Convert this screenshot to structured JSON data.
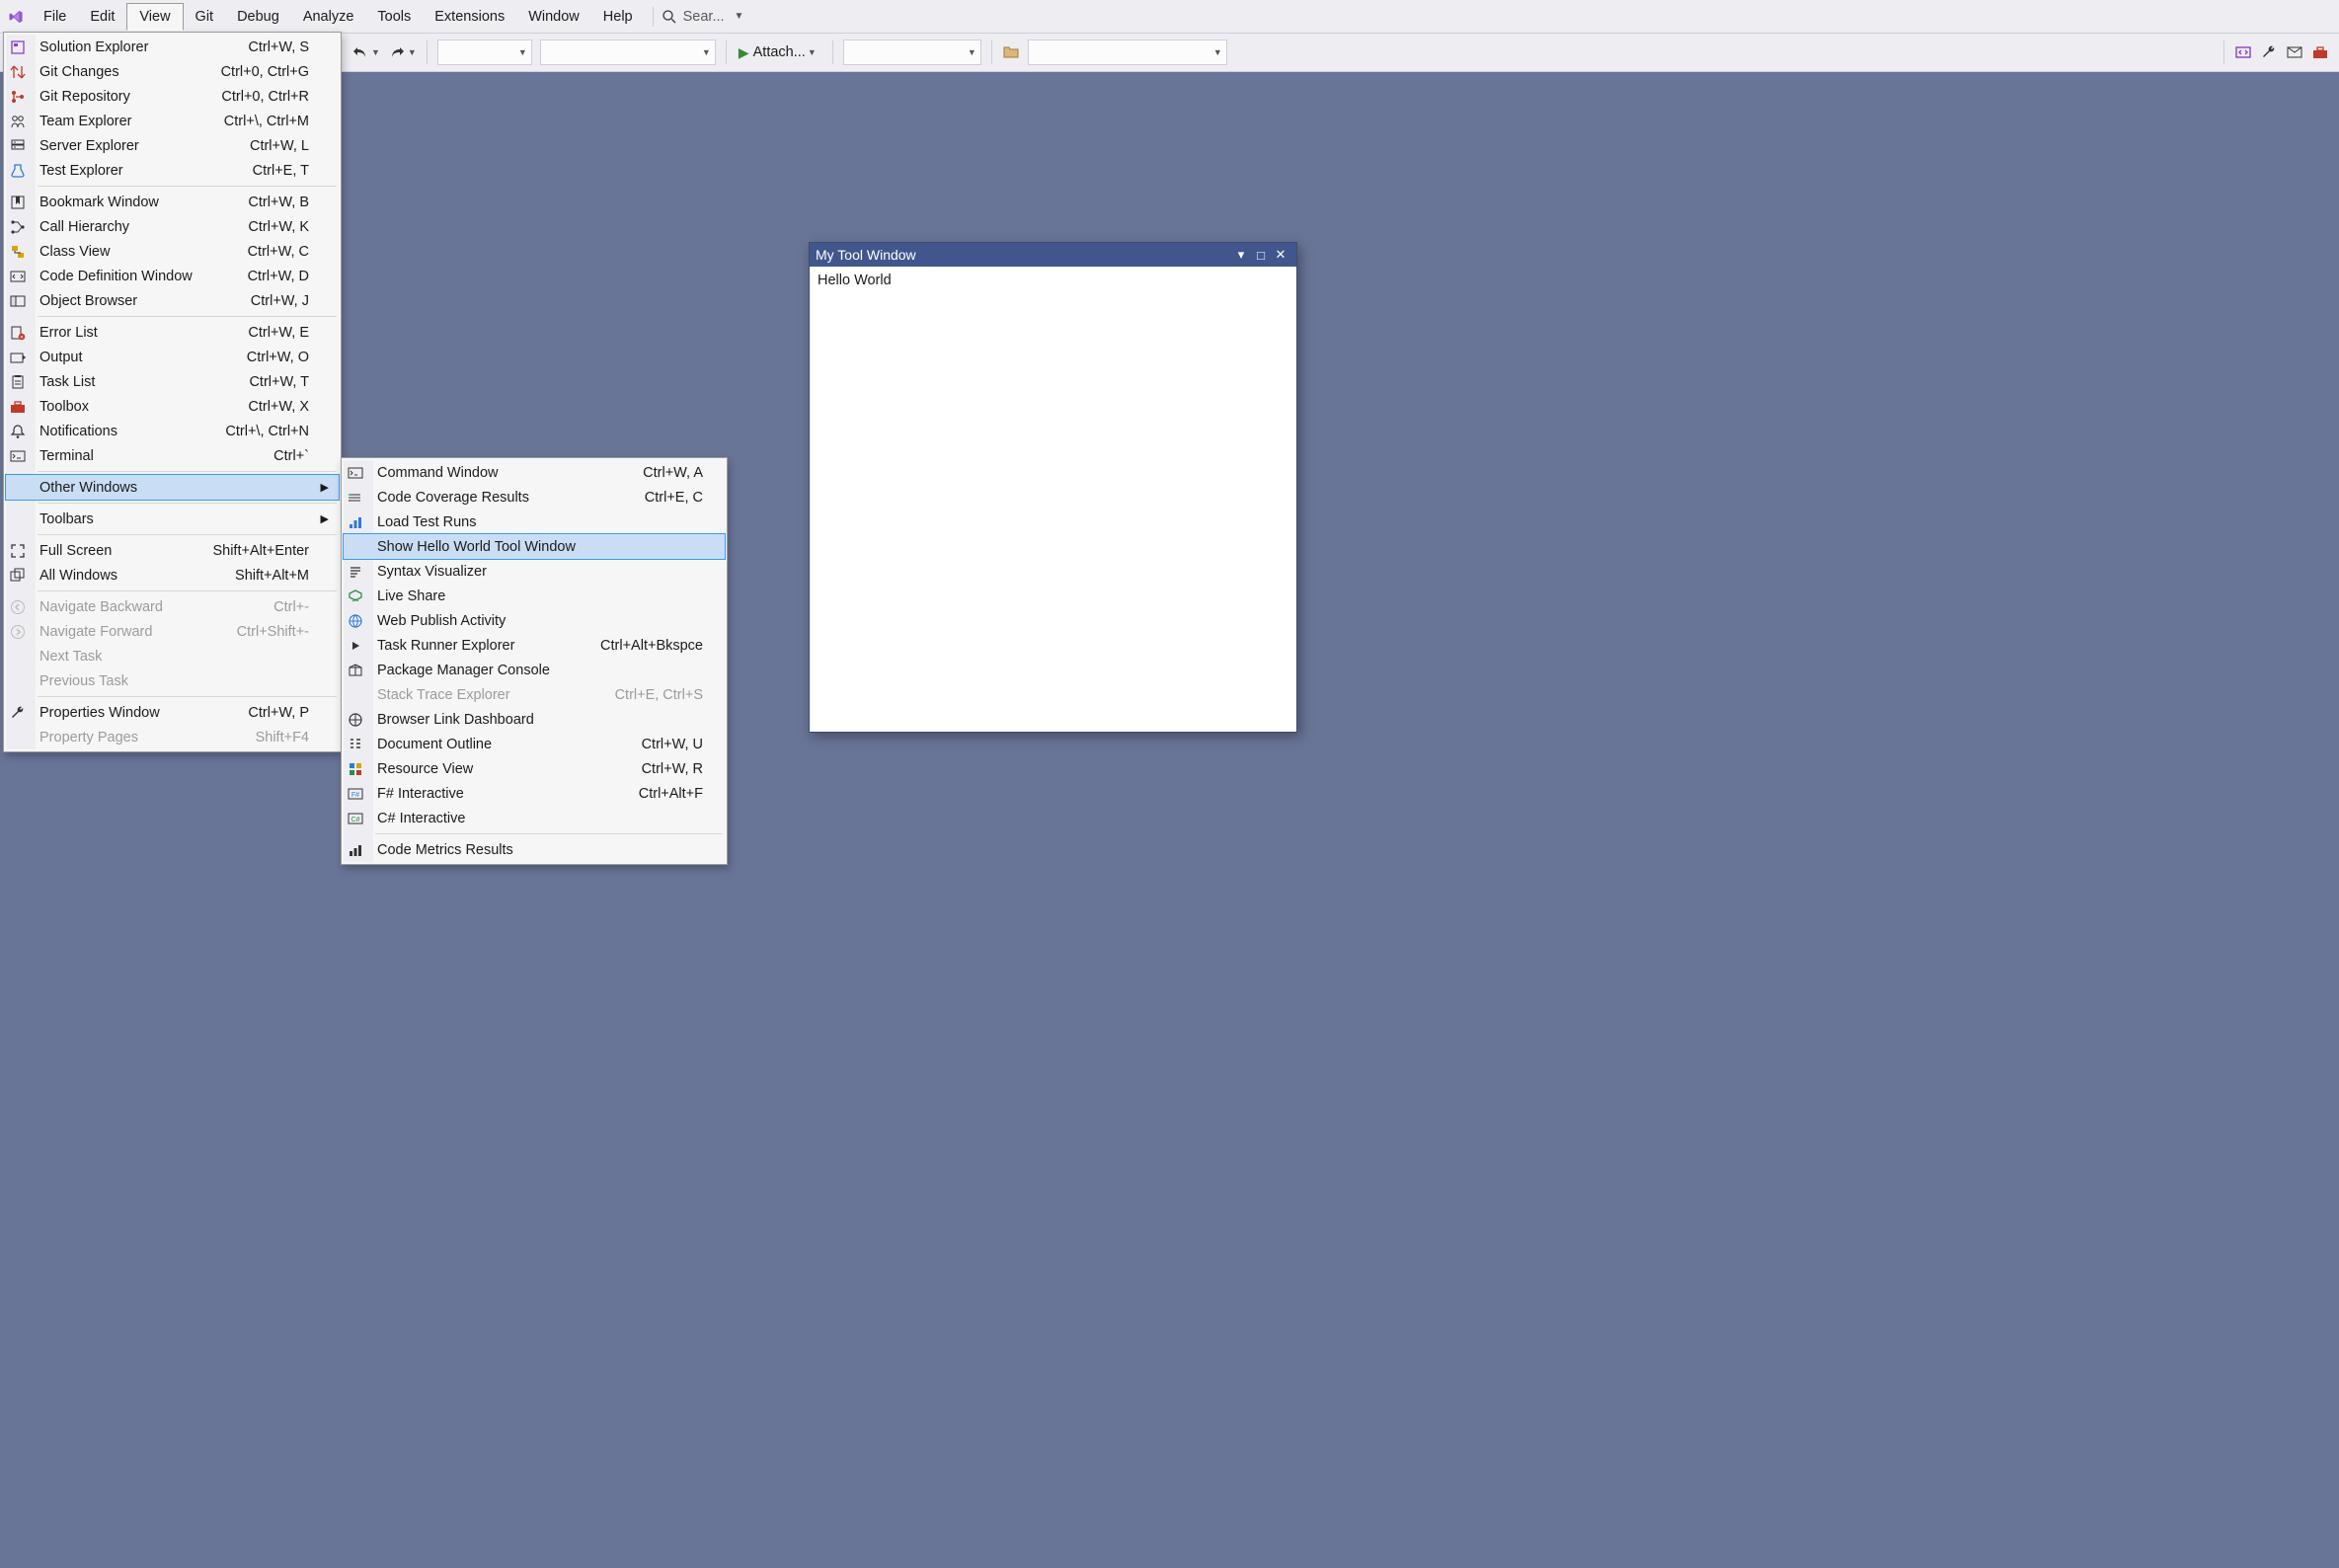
{
  "menubar": {
    "items": [
      "File",
      "Edit",
      "View",
      "Git",
      "Debug",
      "Analyze",
      "Tools",
      "Extensions",
      "Window",
      "Help"
    ],
    "active_index": 2,
    "search_placeholder": "Sear..."
  },
  "toolbar": {
    "attach_label": "Attach..."
  },
  "view_menu": {
    "groups": [
      [
        {
          "icon": "solution-explorer-icon",
          "label": "Solution Explorer",
          "shortcut": "Ctrl+W, S"
        },
        {
          "icon": "git-changes-icon",
          "label": "Git Changes",
          "shortcut": "Ctrl+0, Ctrl+G"
        },
        {
          "icon": "git-repo-icon",
          "label": "Git Repository",
          "shortcut": "Ctrl+0, Ctrl+R"
        },
        {
          "icon": "team-explorer-icon",
          "label": "Team Explorer",
          "shortcut": "Ctrl+\\, Ctrl+M"
        },
        {
          "icon": "server-explorer-icon",
          "label": "Server Explorer",
          "shortcut": "Ctrl+W, L"
        },
        {
          "icon": "test-explorer-icon",
          "label": "Test Explorer",
          "shortcut": "Ctrl+E, T"
        }
      ],
      [
        {
          "icon": "bookmark-window-icon",
          "label": "Bookmark Window",
          "shortcut": "Ctrl+W, B"
        },
        {
          "icon": "call-hierarchy-icon",
          "label": "Call Hierarchy",
          "shortcut": "Ctrl+W, K"
        },
        {
          "icon": "class-view-icon",
          "label": "Class View",
          "shortcut": "Ctrl+W, C"
        },
        {
          "icon": "code-def-window-icon",
          "label": "Code Definition Window",
          "shortcut": "Ctrl+W, D"
        },
        {
          "icon": "object-browser-icon",
          "label": "Object Browser",
          "shortcut": "Ctrl+W, J"
        }
      ],
      [
        {
          "icon": "error-list-icon",
          "label": "Error List",
          "shortcut": "Ctrl+W, E"
        },
        {
          "icon": "output-icon",
          "label": "Output",
          "shortcut": "Ctrl+W, O"
        },
        {
          "icon": "task-list-icon",
          "label": "Task List",
          "shortcut": "Ctrl+W, T"
        },
        {
          "icon": "toolbox-icon",
          "label": "Toolbox",
          "shortcut": "Ctrl+W, X"
        },
        {
          "icon": "notifications-icon",
          "label": "Notifications",
          "shortcut": "Ctrl+\\, Ctrl+N"
        },
        {
          "icon": "terminal-icon",
          "label": "Terminal",
          "shortcut": "Ctrl+`"
        }
      ],
      [
        {
          "icon": "",
          "label": "Other Windows",
          "shortcut": "",
          "submenu": true,
          "highlight": true
        }
      ],
      [
        {
          "icon": "",
          "label": "Toolbars",
          "shortcut": "",
          "submenu": true
        }
      ],
      [
        {
          "icon": "full-screen-icon",
          "label": "Full Screen",
          "shortcut": "Shift+Alt+Enter"
        },
        {
          "icon": "all-windows-icon",
          "label": "All Windows",
          "shortcut": "Shift+Alt+M"
        }
      ],
      [
        {
          "icon": "nav-back-icon",
          "label": "Navigate Backward",
          "shortcut": "Ctrl+-",
          "disabled": true
        },
        {
          "icon": "nav-fwd-icon",
          "label": "Navigate Forward",
          "shortcut": "Ctrl+Shift+-",
          "disabled": true
        },
        {
          "icon": "",
          "label": "Next Task",
          "shortcut": "",
          "disabled": true
        },
        {
          "icon": "",
          "label": "Previous Task",
          "shortcut": "",
          "disabled": true
        }
      ],
      [
        {
          "icon": "properties-icon",
          "label": "Properties Window",
          "shortcut": "Ctrl+W, P"
        },
        {
          "icon": "",
          "label": "Property Pages",
          "shortcut": "Shift+F4",
          "disabled": true
        }
      ]
    ]
  },
  "other_windows_menu": {
    "groups": [
      [
        {
          "icon": "command-window-icon",
          "label": "Command Window",
          "shortcut": "Ctrl+W, A"
        },
        {
          "icon": "code-coverage-icon",
          "label": "Code Coverage Results",
          "shortcut": "Ctrl+E, C"
        },
        {
          "icon": "load-test-icon",
          "label": "Load Test Runs",
          "shortcut": ""
        },
        {
          "icon": "",
          "label": "Show Hello World Tool Window",
          "shortcut": "",
          "highlight": true
        },
        {
          "icon": "syntax-visualizer-icon",
          "label": "Syntax Visualizer",
          "shortcut": ""
        },
        {
          "icon": "live-share-icon",
          "label": "Live Share",
          "shortcut": ""
        },
        {
          "icon": "web-publish-icon",
          "label": "Web Publish Activity",
          "shortcut": ""
        },
        {
          "icon": "task-runner-icon",
          "label": "Task Runner Explorer",
          "shortcut": "Ctrl+Alt+Bkspce"
        },
        {
          "icon": "pkg-manager-icon",
          "label": "Package Manager Console",
          "shortcut": ""
        },
        {
          "icon": "",
          "label": "Stack Trace Explorer",
          "shortcut": "Ctrl+E, Ctrl+S",
          "disabled": true
        },
        {
          "icon": "browser-link-icon",
          "label": "Browser Link Dashboard",
          "shortcut": ""
        },
        {
          "icon": "doc-outline-icon",
          "label": "Document Outline",
          "shortcut": "Ctrl+W, U"
        },
        {
          "icon": "resource-view-icon",
          "label": "Resource View",
          "shortcut": "Ctrl+W, R"
        },
        {
          "icon": "fsharp-icon",
          "label": "F# Interactive",
          "shortcut": "Ctrl+Alt+F"
        },
        {
          "icon": "csharp-icon",
          "label": "C# Interactive",
          "shortcut": ""
        }
      ],
      [
        {
          "icon": "code-metrics-icon",
          "label": "Code Metrics Results",
          "shortcut": ""
        }
      ]
    ]
  },
  "tool_window": {
    "title": "My Tool Window",
    "body": "Hello World"
  }
}
